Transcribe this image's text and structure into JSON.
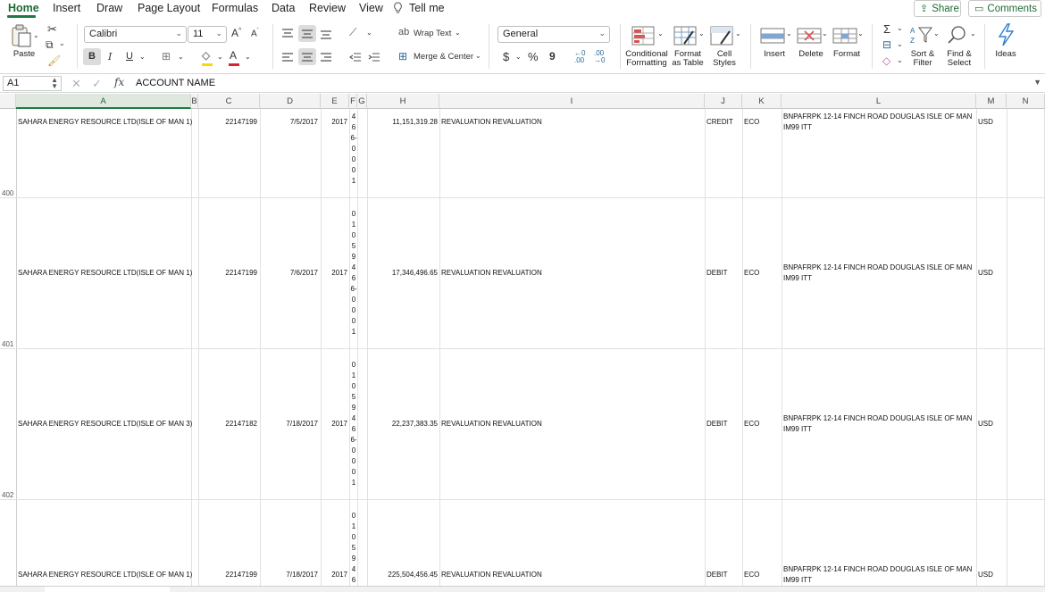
{
  "menu": {
    "tabs": [
      "Home",
      "Insert",
      "Draw",
      "Page Layout",
      "Formulas",
      "Data",
      "Review",
      "View"
    ],
    "tell_me": "Tell me",
    "share": "Share",
    "comments": "Comments"
  },
  "ribbon": {
    "paste": "Paste",
    "font_name": "Calibri",
    "font_size": "11",
    "bold": "B",
    "italic": "I",
    "underline": "U",
    "grow_font": "A^",
    "shrink_font": "A^",
    "wrap_text": "Wrap Text",
    "merge_center": "Merge & Center",
    "number_format": "General",
    "currency": "$",
    "percent": "%",
    "comma": "9",
    "conditional_formatting": [
      "Conditional",
      "Formatting"
    ],
    "format_as_table": [
      "Format",
      "as Table"
    ],
    "cell_styles": [
      "Cell",
      "Styles"
    ],
    "insert": "Insert",
    "delete": "Delete",
    "format": "Format",
    "sort_filter": [
      "Sort &",
      "Filter"
    ],
    "find_select": [
      "Find &",
      "Select"
    ],
    "ideas": "Ideas",
    "accent_color": "#1e7b44",
    "fill_color": "#f5d90a",
    "font_color": "#d6262b"
  },
  "formula_bar": {
    "name_box": "A1",
    "fx": "fx",
    "value": "ACCOUNT NAME"
  },
  "columns": [
    "A",
    "B",
    "C",
    "D",
    "E",
    "F",
    "G",
    "H",
    "I",
    "J",
    "K",
    "L",
    "M",
    "N"
  ],
  "selected_column": "A",
  "rows": [
    {
      "row_number": "400",
      "account_name": "SAHARA ENERGY RESOURCE LTD(ISLE OF MAN 1)",
      "account_no": "22147199",
      "date": "7/5/2017",
      "year": "2017",
      "f_chars": [
        "4",
        "6",
        "6-",
        "0",
        "0",
        "0",
        "1"
      ],
      "amount": "11,151,319.28",
      "description": "REVALUATION REVALUATION",
      "type": "CREDIT",
      "code": "ECO",
      "address_line1": "BNPAFRPK 12-14 FINCH ROAD DOUGLAS ISLE OF MAN",
      "address_line2": "IM99 ITT",
      "currency": "USD"
    },
    {
      "row_number": "401",
      "account_name": "SAHARA ENERGY RESOURCE LTD(ISLE OF MAN 1)",
      "account_no": "22147199",
      "date": "7/6/2017",
      "year": "2017",
      "f_chars": [
        "0",
        "1",
        "0",
        "5",
        "9",
        "4",
        "6",
        "6-",
        "0",
        "0",
        "0",
        "1"
      ],
      "amount": "17,346,496.65",
      "description": "REVALUATION REVALUATION",
      "type": "DEBIT",
      "code": "ECO",
      "address_line1": "BNPAFRPK 12-14 FINCH ROAD DOUGLAS ISLE OF MAN",
      "address_line2": "IM99 ITT",
      "currency": "USD"
    },
    {
      "row_number": "402",
      "account_name": "SAHARA ENERGY RESOURCE LTD(ISLE OF MAN 3)",
      "account_no": "22147182",
      "date": "7/18/2017",
      "year": "2017",
      "f_chars": [
        "0",
        "1",
        "0",
        "5",
        "9",
        "4",
        "6",
        "6-",
        "0",
        "0",
        "0",
        "1"
      ],
      "amount": "22,237,383.35",
      "description": "REVALUATION REVALUATION",
      "type": "DEBIT",
      "code": "ECO",
      "address_line1": "BNPAFRPK 12-14 FINCH ROAD DOUGLAS ISLE OF MAN",
      "address_line2": "IM99 ITT",
      "currency": "USD"
    },
    {
      "row_number": "",
      "account_name": "SAHARA ENERGY RESOURCE LTD(ISLE OF MAN 1)",
      "account_no": "22147199",
      "date": "7/18/2017",
      "year": "2017",
      "f_chars": [
        "0",
        "1",
        "0",
        "5",
        "9",
        "4",
        "6"
      ],
      "amount": "225,504,456.45",
      "description": "REVALUATION REVALUATION",
      "type": "DEBIT",
      "code": "ECO",
      "address_line1": "BNPAFRPK 12-14 FINCH ROAD DOUGLAS ISLE OF MAN",
      "address_line2": "IM99 ITT",
      "currency": "USD"
    }
  ]
}
